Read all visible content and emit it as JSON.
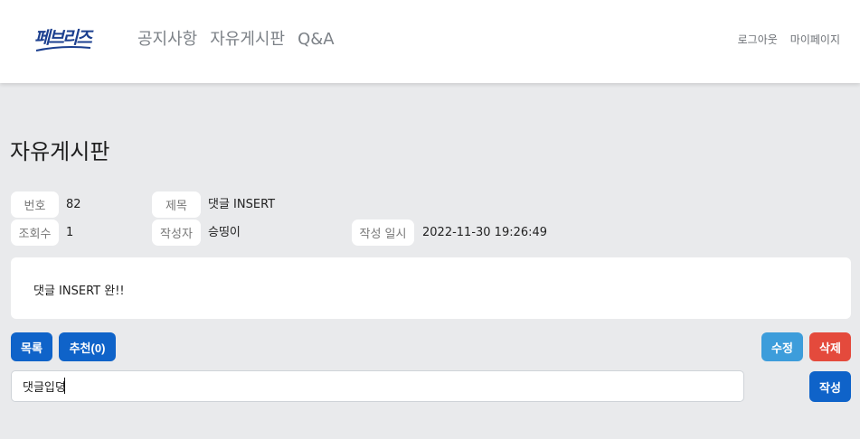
{
  "nav": {
    "logo_text": "페브리즈",
    "brand_color": "#1b3f8f",
    "menu": [
      "공지사항",
      "자유게시판",
      "Q&A"
    ],
    "logout": "로그아웃",
    "mypage": "마이페이지"
  },
  "page": {
    "title": "자유게시판"
  },
  "post": {
    "no_label": "번호",
    "no_value": "82",
    "title_label": "제목",
    "title_value": "댓글 INSERT",
    "views_label": "조회수",
    "views_value": "1",
    "author_label": "작성자",
    "author_value": "승띵이",
    "date_label": "작성 일시",
    "date_value": "2022-11-30 19:26:49",
    "content": "댓글 INSERT 완!!"
  },
  "buttons": {
    "list": "목록",
    "recommend": "추천(0)",
    "edit": "수정",
    "delete": "삭제",
    "write": "작성"
  },
  "comment": {
    "value": "댓글입뎡"
  },
  "colors": {
    "primary": "#0f63c9",
    "edit": "#3d9ddb",
    "delete": "#e44a3c",
    "background": "#e9eaec"
  }
}
